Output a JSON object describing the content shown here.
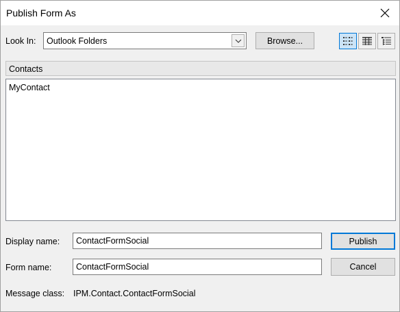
{
  "window": {
    "title": "Publish Form As",
    "close_icon": "close-icon"
  },
  "look_in": {
    "label": "Look In:",
    "value": "Outlook Folders",
    "browse_label": "Browse..."
  },
  "view_buttons": [
    {
      "icon": "list-view-icon",
      "active": true
    },
    {
      "icon": "details-view-icon",
      "active": false
    },
    {
      "icon": "properties-view-icon",
      "active": false
    }
  ],
  "folder": {
    "current": "Contacts",
    "items": [
      "MyContact"
    ]
  },
  "fields": {
    "display_name_label": "Display name:",
    "display_name_value": "ContactFormSocial",
    "form_name_label": "Form name:",
    "form_name_value": "ContactFormSocial",
    "message_class_label": "Message class:",
    "message_class_value": "IPM.Contact.ContactFormSocial"
  },
  "actions": {
    "publish_label": "Publish",
    "cancel_label": "Cancel"
  },
  "colors": {
    "accent": "#0078d7",
    "dialog_bg": "#f0f0f0"
  }
}
